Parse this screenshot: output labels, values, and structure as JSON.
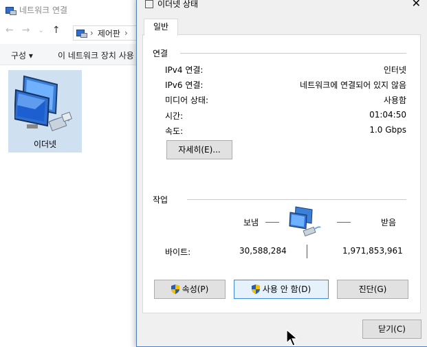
{
  "bg": {
    "title": "네트워크 연결",
    "nav_back": "←",
    "nav_fwd": "→",
    "nav_down": "⌄",
    "nav_up": "↑",
    "breadcrumb": "제어판",
    "cmd_organize": "구성 ▾",
    "cmd_disable": "이 네트워크 장치 사용",
    "item_label": "이더넷"
  },
  "dialog": {
    "title": "이더넷 상태",
    "close": "✕",
    "tab": "일반",
    "connection_header": "연결",
    "rows": [
      {
        "label": "IPv4 연결:",
        "value": "인터넷"
      },
      {
        "label": "IPv6 연결:",
        "value": "네트워크에 연결되어 있지 않음"
      },
      {
        "label": "미디어 상태:",
        "value": "사용함"
      },
      {
        "label": "시간:",
        "value": "01:04:50"
      },
      {
        "label": "속도:",
        "value": "1.0 Gbps"
      }
    ],
    "details_button": "자세히(E)...",
    "activity_header": "작업",
    "sent_label": "보냄",
    "received_label": "받음",
    "bytes_label": "바이트:",
    "bytes_sent": "30,588,284",
    "bytes_received": "1,971,853,961",
    "properties_button": "속성(P)",
    "disable_button": "사용 안 함(D)",
    "diagnose_button": "진단(G)",
    "close_button": "닫기(C)"
  },
  "colors": {
    "accent": "#3c8ad8",
    "selection": "#cfe0f0"
  }
}
